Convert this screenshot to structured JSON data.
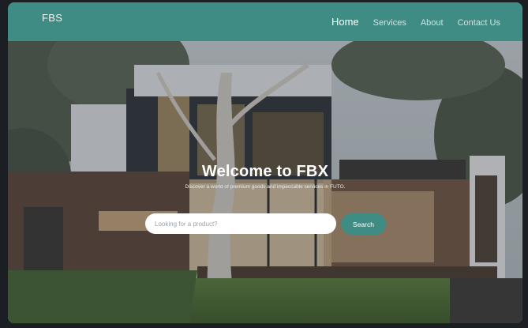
{
  "brand": "FBS",
  "nav": {
    "home": "Home",
    "services": "Services",
    "about": "About",
    "contact": "Contact Us"
  },
  "hero": {
    "title": "Welcome to FBX",
    "subtitle": "Discover a world of premium goods and impeccable services in FUTO."
  },
  "search": {
    "placeholder": "Looking for a product?",
    "button_label": "Search"
  },
  "colors": {
    "accent": "#3f8c84",
    "background": "#1b1f24"
  }
}
